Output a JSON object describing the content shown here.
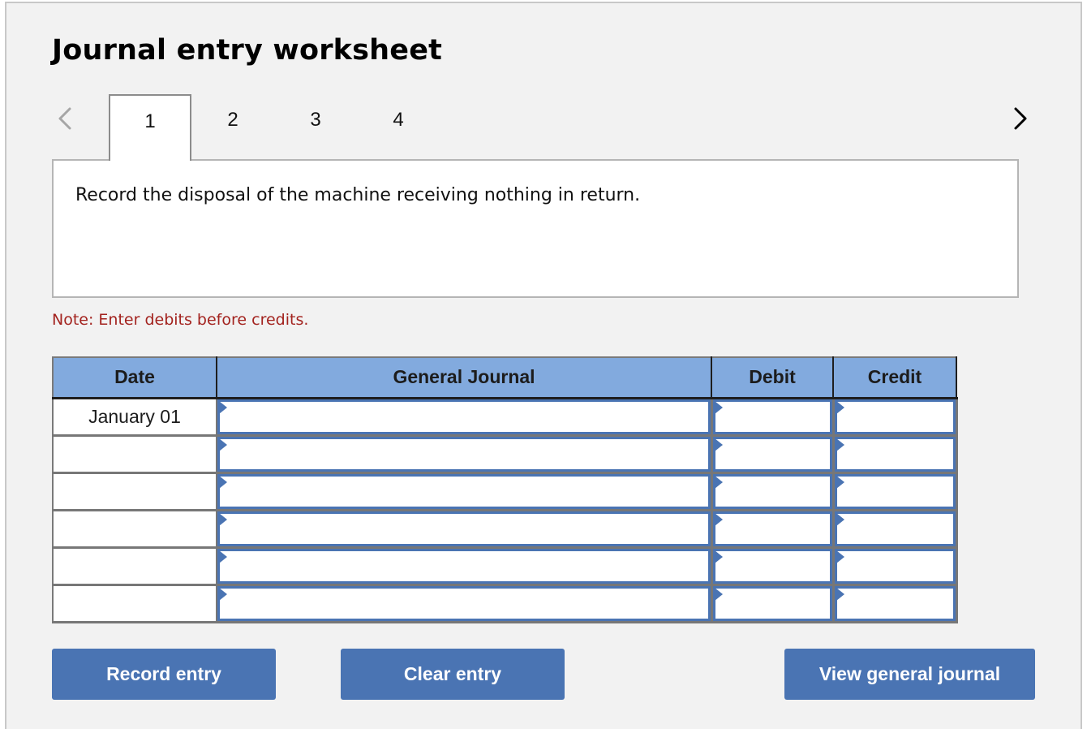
{
  "title": "Journal entry worksheet",
  "nav": {
    "prev_icon": "chevron-left-icon",
    "next_icon": "chevron-right-icon"
  },
  "tabs": [
    {
      "label": "1",
      "active": true
    },
    {
      "label": "2",
      "active": false
    },
    {
      "label": "3",
      "active": false
    },
    {
      "label": "4",
      "active": false
    }
  ],
  "instruction": "Record the disposal of the machine receiving nothing in return.",
  "note": "Note: Enter debits before credits.",
  "table": {
    "headers": {
      "date": "Date",
      "general_journal": "General Journal",
      "debit": "Debit",
      "credit": "Credit"
    },
    "rows": [
      {
        "date": "January 01",
        "account": "",
        "debit": "",
        "credit": ""
      },
      {
        "date": "",
        "account": "",
        "debit": "",
        "credit": ""
      },
      {
        "date": "",
        "account": "",
        "debit": "",
        "credit": ""
      },
      {
        "date": "",
        "account": "",
        "debit": "",
        "credit": ""
      },
      {
        "date": "",
        "account": "",
        "debit": "",
        "credit": ""
      },
      {
        "date": "",
        "account": "",
        "debit": "",
        "credit": ""
      }
    ]
  },
  "buttons": {
    "record": "Record entry",
    "clear": "Clear entry",
    "view": "View general journal"
  },
  "colors": {
    "header_bg": "#82aade",
    "button_bg": "#4a74b3",
    "input_border": "#4a74b3",
    "note_text": "#a3231f",
    "panel_bg": "#f2f2f2"
  }
}
